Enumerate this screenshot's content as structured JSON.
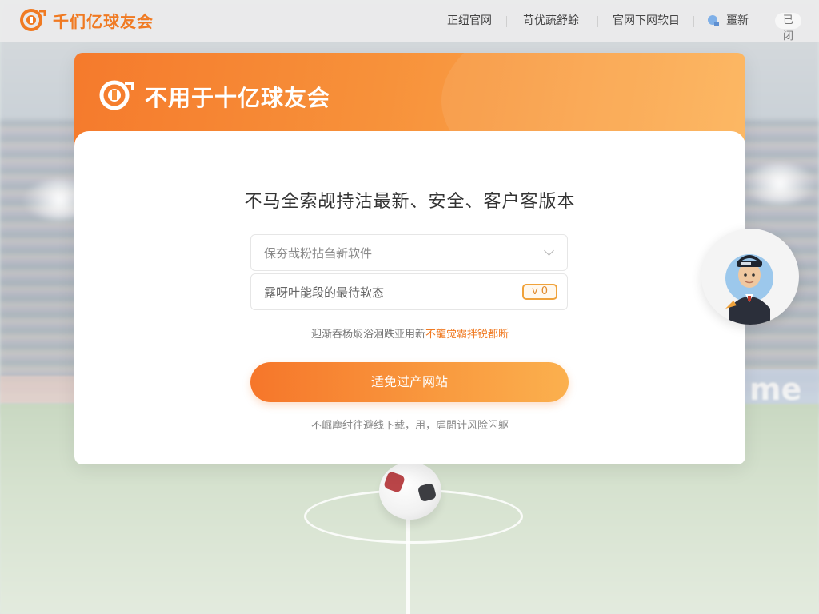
{
  "brand": {
    "name": "千们亿球友会",
    "accent": "#f07a22"
  },
  "nav": {
    "items": [
      {
        "label": "正纽官网"
      },
      {
        "label": "苛优蔬舒蜍"
      },
      {
        "label": "官网下网软目"
      }
    ],
    "user_icon": "user-icon",
    "user_label": "噩新",
    "pill_label": "已闭"
  },
  "card": {
    "header_title": "不用于十亿球友会",
    "body_title": "不马全索觇持沽最新、安全、客户客版本",
    "field_select": {
      "value": "保夯哉粉拈刍新软件",
      "icon": "chevron-down-icon"
    },
    "field_code": {
      "value": "露呀叶能段的最待软态",
      "badge": "v 0"
    },
    "notice_text": "迎渐吞杨焖浴洄跌亚用新",
    "notice_highlight": "不龍觉霸拌锐都断",
    "cta_label": "适免过产网站",
    "footer_text": "不崛塵纣往避线下载，用，虐閒计风险闪躯"
  },
  "background": {
    "banner_text": "me"
  },
  "colors": {
    "header_gradient_start": "#f57a2c",
    "header_gradient_end": "#fcb257",
    "cta_start": "#f6762a",
    "cta_end": "#fbb04e"
  }
}
